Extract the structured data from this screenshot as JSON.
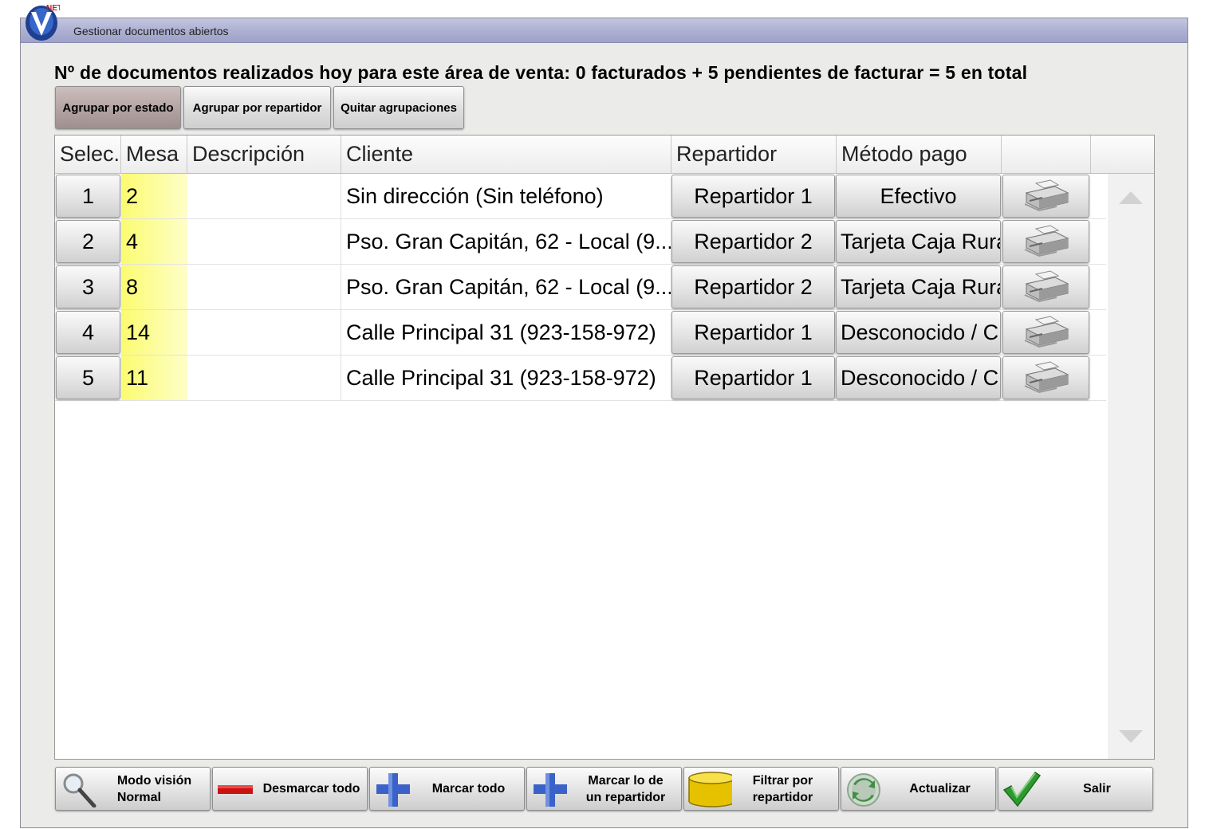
{
  "window": {
    "title": "Gestionar documentos abiertos",
    "logo_text": "NET"
  },
  "headline": "Nº de documentos realizados hoy para este área de venta: 0 facturados + 5 pendientes de facturar = 5 en total",
  "grouping": {
    "by_state": "Agrupar por estado",
    "by_courier": "Agrupar por repartidor",
    "remove": "Quitar agrupaciones"
  },
  "columns": {
    "select": "Selec.",
    "table": "Mesa",
    "description": "Descripción",
    "client": "Cliente",
    "courier": "Repartidor",
    "payment": "Método pago",
    "print": ""
  },
  "rows": [
    {
      "select": "1",
      "table": "2",
      "description": "",
      "client": "Sin dirección (Sin teléfono)",
      "courier": "Repartidor 1",
      "payment": "Efectivo",
      "print_icon": "printer-icon"
    },
    {
      "select": "2",
      "table": "4",
      "description": "",
      "client": "Pso. Gran Capitán, 62 - Local (9...",
      "courier": "Repartidor 2",
      "payment": "Tarjeta Caja Rura",
      "print_icon": "printer-icon"
    },
    {
      "select": "3",
      "table": "8",
      "description": "",
      "client": "Pso. Gran Capitán, 62 - Local (9...",
      "courier": "Repartidor 2",
      "payment": "Tarjeta Caja Rura",
      "print_icon": "printer-icon"
    },
    {
      "select": "4",
      "table": "14",
      "description": "",
      "client": "Calle Principal 31 (923-158-972)",
      "courier": "Repartidor 1",
      "payment": "Desconocido / C",
      "print_icon": "printer-icon"
    },
    {
      "select": "5",
      "table": "11",
      "description": "",
      "client": "Calle Principal 31 (923-158-972)",
      "courier": "Repartidor 1",
      "payment": "Desconocido / C",
      "print_icon": "printer-icon"
    }
  ],
  "toolbar": {
    "view_mode": {
      "line1": "Modo visión",
      "line2": "Normal",
      "icon": "magnifier-icon"
    },
    "unmark_all": {
      "label": "Desmarcar todo",
      "icon": "minus-icon"
    },
    "mark_all": {
      "label": "Marcar todo",
      "icon": "plus-icon"
    },
    "mark_courier": {
      "line1": "Marcar lo de",
      "line2": "un repartidor",
      "icon": "plus-icon"
    },
    "filter_courier": {
      "line1": "Filtrar por",
      "line2": "repartidor",
      "icon": "cylinder-icon"
    },
    "refresh": {
      "label": "Actualizar",
      "icon": "refresh-icon"
    },
    "exit": {
      "label": "Salir",
      "icon": "checkmark-icon"
    }
  },
  "colors": {
    "highlight_table_cell": "#fbfb70",
    "title_bar": "#aeb1d2",
    "unmark_red": "#cc1111",
    "plus_blue": "#3a62c8",
    "cylinder_yellow": "#e6c100",
    "check_green": "#2e9a2e"
  }
}
